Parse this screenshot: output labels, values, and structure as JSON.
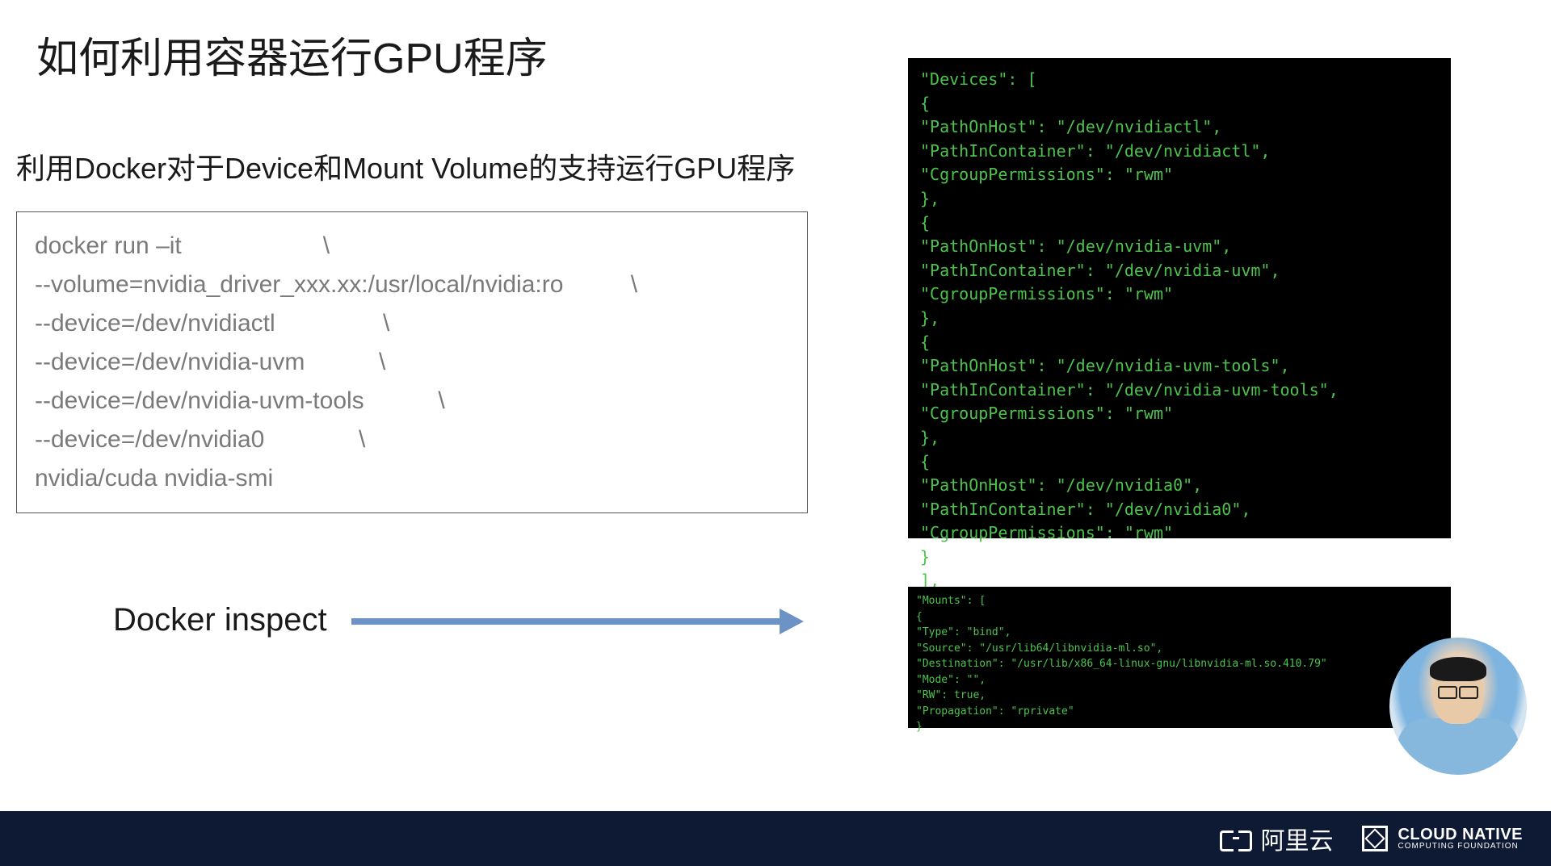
{
  "slide": {
    "title": "如何利用容器运行GPU程序",
    "subtitle": "利用Docker对于Device和Mount Volume的支持运行GPU程序",
    "cmd": {
      "l1": "docker run –it                     \\",
      "l2": "--volume=nvidia_driver_xxx.xx:/usr/local/nvidia:ro          \\",
      "l3": "--device=/dev/nvidiactl                \\",
      "l4": "--device=/dev/nvidia-uvm           \\",
      "l5": "--device=/dev/nvidia-uvm-tools           \\",
      "l6": "--device=/dev/nvidia0              \\",
      "l7": "nvidia/cuda nvidia-smi"
    },
    "inspect_label": "Docker inspect"
  },
  "term_devices": {
    "l01": "\"Devices\": [",
    "l02": "    {",
    "l03": "        \"PathOnHost\": \"/dev/nvidiactl\",",
    "l04": "        \"PathInContainer\": \"/dev/nvidiactl\",",
    "l05": "        \"CgroupPermissions\": \"rwm\"",
    "l06": "    },",
    "l07": "    {",
    "l08": "        \"PathOnHost\": \"/dev/nvidia-uvm\",",
    "l09": "        \"PathInContainer\": \"/dev/nvidia-uvm\",",
    "l10": "        \"CgroupPermissions\": \"rwm\"",
    "l11": "    },",
    "l12": "    {",
    "l13": "        \"PathOnHost\": \"/dev/nvidia-uvm-tools\",",
    "l14": "        \"PathInContainer\": \"/dev/nvidia-uvm-tools\",",
    "l15": "        \"CgroupPermissions\": \"rwm\"",
    "l16": "    },",
    "l17": "    {",
    "l18": "        \"PathOnHost\": \"/dev/nvidia0\",",
    "l19": "        \"PathInContainer\": \"/dev/nvidia0\",",
    "l20": "        \"CgroupPermissions\": \"rwm\"",
    "l21": "    }",
    "l22": "],"
  },
  "term_mounts": {
    "l01": "\"Mounts\": [",
    "l02": "    {",
    "l03": "        \"Type\": \"bind\",",
    "l04": "        \"Source\": \"/usr/lib64/libnvidia-ml.so\",",
    "l05": "        \"Destination\": \"/usr/lib/x86_64-linux-gnu/libnvidia-ml.so.410.79\"",
    "l06": "        \"Mode\": \"\",",
    "l07": "        \"RW\": true,",
    "l08": "        \"Propagation\": \"rprivate\"",
    "l09": "    }"
  },
  "footer": {
    "aliyun": "阿里云",
    "cncf_l1": "CLOUD NATIVE",
    "cncf_l2": "COMPUTING FOUNDATION"
  }
}
